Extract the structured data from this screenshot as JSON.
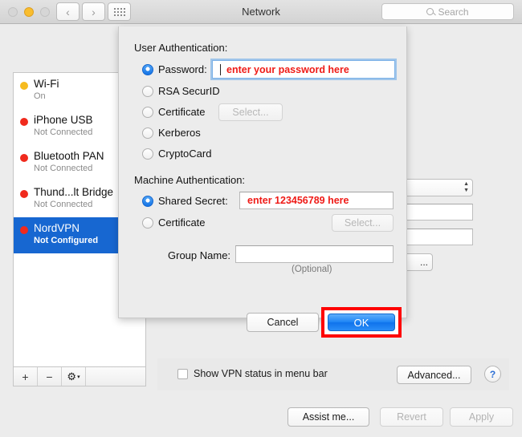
{
  "window": {
    "title": "Network",
    "nav": {
      "back": "‹",
      "forward": "›"
    },
    "grid_icon": "show-all-icon",
    "search": {
      "placeholder": "Search",
      "value": ""
    }
  },
  "sidebar": {
    "services": [
      {
        "name": "Wi-Fi",
        "status": "On",
        "dot": "yellow",
        "selected": false
      },
      {
        "name": "iPhone USB",
        "status": "Not Connected",
        "dot": "red",
        "selected": false
      },
      {
        "name": "Bluetooth PAN",
        "status": "Not Connected",
        "dot": "red",
        "selected": false
      },
      {
        "name": "Thund...lt Bridge",
        "status": "Not Connected",
        "dot": "red",
        "selected": false
      },
      {
        "name": "NordVPN",
        "status": "Not Configured",
        "dot": "red",
        "selected": true
      }
    ],
    "toolbar": {
      "add": "+",
      "remove": "−",
      "gear": "⚙",
      "chevron": "▾"
    }
  },
  "background_panel": {
    "hidden_button_label": "..."
  },
  "vpn_bar": {
    "show_status_label": "Show VPN status in menu bar",
    "show_status_checked": false,
    "advanced_label": "Advanced...",
    "help_label": "?"
  },
  "footer": {
    "assist_label": "Assist me...",
    "revert_label": "Revert",
    "apply_label": "Apply",
    "revert_disabled": true,
    "apply_disabled": true
  },
  "sheet": {
    "user_auth_label": "User Authentication:",
    "user_auth_options": [
      {
        "label": "Password:",
        "selected": true
      },
      {
        "label": "RSA SecurID",
        "selected": false
      },
      {
        "label": "Certificate",
        "selected": false
      },
      {
        "label": "Kerberos",
        "selected": false
      },
      {
        "label": "CryptoCard",
        "selected": false
      }
    ],
    "password_field": {
      "value": "enter your password here",
      "focused": true
    },
    "user_cert_select_label": "Select...",
    "machine_auth_label": "Machine Authentication:",
    "machine_auth_options": [
      {
        "label": "Shared Secret:",
        "selected": true
      },
      {
        "label": "Certificate",
        "selected": false
      }
    ],
    "shared_secret_field": {
      "value": "enter 123456789 here",
      "focused": false
    },
    "machine_cert_select_label": "Select...",
    "group_name_label": "Group Name:",
    "group_name_value": "",
    "optional_label": "(Optional)",
    "cancel_label": "Cancel",
    "ok_label": "OK"
  },
  "colors": {
    "accent_blue": "#1767d1",
    "highlight_red": "#fe0000",
    "placeholder_red": "#ef1b17",
    "status_yellow": "#f6bb1f",
    "status_red": "#f02a1d"
  }
}
